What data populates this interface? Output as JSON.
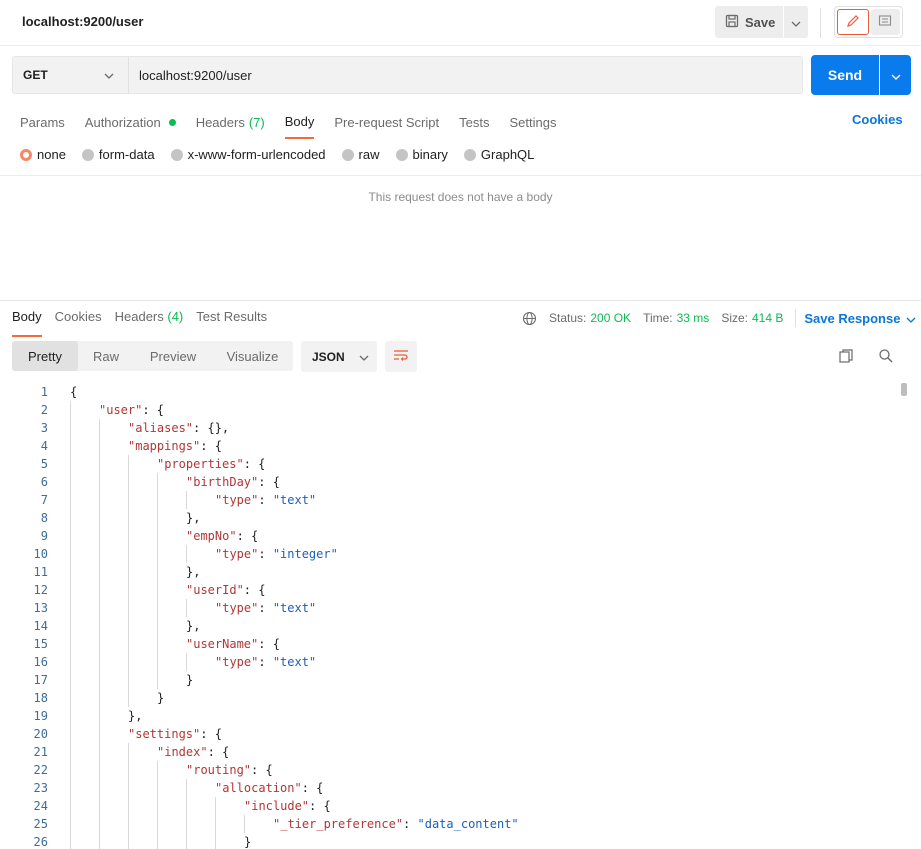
{
  "request": {
    "title": "localhost:9200/user",
    "save_label": "Save",
    "method": "GET",
    "url": "localhost:9200/user",
    "send_label": "Send",
    "tabs": [
      {
        "label": "Params"
      },
      {
        "label": "Authorization"
      },
      {
        "label": "Headers",
        "count": "(7)"
      },
      {
        "label": "Body"
      },
      {
        "label": "Pre-request Script"
      },
      {
        "label": "Tests"
      },
      {
        "label": "Settings"
      }
    ],
    "cookies_label": "Cookies",
    "body_types": [
      "none",
      "form-data",
      "x-www-form-urlencoded",
      "raw",
      "binary",
      "GraphQL"
    ],
    "selected_body_type": "none",
    "no_body_text": "This request does not have a body"
  },
  "response": {
    "tabs": [
      {
        "label": "Body"
      },
      {
        "label": "Cookies"
      },
      {
        "label": "Headers",
        "count": "(4)"
      },
      {
        "label": "Test Results"
      }
    ],
    "status_label": "Status:",
    "status_value": "200 OK",
    "time_label": "Time:",
    "time_value": "33 ms",
    "size_label": "Size:",
    "size_value": "414 B",
    "save_response_label": "Save Response",
    "views": [
      "Pretty",
      "Raw",
      "Preview",
      "Visualize"
    ],
    "active_view": "Pretty",
    "format": "JSON",
    "colors": {
      "accent": "#f26b3a",
      "send": "#097bed",
      "success": "#0cbb52",
      "link": "#0b76d8",
      "json_key": "#b23636",
      "json_string": "#1c5fb8"
    },
    "code_lines": [
      {
        "n": "1",
        "depth": 0,
        "text": "{"
      },
      {
        "n": "2",
        "depth": 1,
        "key": "\"user\"",
        "rest": ": {"
      },
      {
        "n": "3",
        "depth": 2,
        "key": "\"aliases\"",
        "rest": ": {},"
      },
      {
        "n": "4",
        "depth": 2,
        "key": "\"mappings\"",
        "rest": ": {"
      },
      {
        "n": "5",
        "depth": 3,
        "key": "\"properties\"",
        "rest": ": {"
      },
      {
        "n": "6",
        "depth": 4,
        "key": "\"birthDay\"",
        "rest": ": {"
      },
      {
        "n": "7",
        "depth": 5,
        "key": "\"type\"",
        "rest": ": ",
        "val": "\"text\""
      },
      {
        "n": "8",
        "depth": 4,
        "text": "},"
      },
      {
        "n": "9",
        "depth": 4,
        "key": "\"empNo\"",
        "rest": ": {"
      },
      {
        "n": "10",
        "depth": 5,
        "key": "\"type\"",
        "rest": ": ",
        "val": "\"integer\""
      },
      {
        "n": "11",
        "depth": 4,
        "text": "},"
      },
      {
        "n": "12",
        "depth": 4,
        "key": "\"userId\"",
        "rest": ": {"
      },
      {
        "n": "13",
        "depth": 5,
        "key": "\"type\"",
        "rest": ": ",
        "val": "\"text\""
      },
      {
        "n": "14",
        "depth": 4,
        "text": "},"
      },
      {
        "n": "15",
        "depth": 4,
        "key": "\"userName\"",
        "rest": ": {"
      },
      {
        "n": "16",
        "depth": 5,
        "key": "\"type\"",
        "rest": ": ",
        "val": "\"text\""
      },
      {
        "n": "17",
        "depth": 4,
        "text": "}"
      },
      {
        "n": "18",
        "depth": 3,
        "text": "}"
      },
      {
        "n": "19",
        "depth": 2,
        "text": "},"
      },
      {
        "n": "20",
        "depth": 2,
        "key": "\"settings\"",
        "rest": ": {"
      },
      {
        "n": "21",
        "depth": 3,
        "key": "\"index\"",
        "rest": ": {"
      },
      {
        "n": "22",
        "depth": 4,
        "key": "\"routing\"",
        "rest": ": {"
      },
      {
        "n": "23",
        "depth": 5,
        "key": "\"allocation\"",
        "rest": ": {"
      },
      {
        "n": "24",
        "depth": 6,
        "key": "\"include\"",
        "rest": ": {"
      },
      {
        "n": "25",
        "depth": 7,
        "key": "\"_tier_preference\"",
        "rest": ": ",
        "val": "\"data_content\""
      },
      {
        "n": "26",
        "depth": 6,
        "text": "}"
      }
    ]
  }
}
